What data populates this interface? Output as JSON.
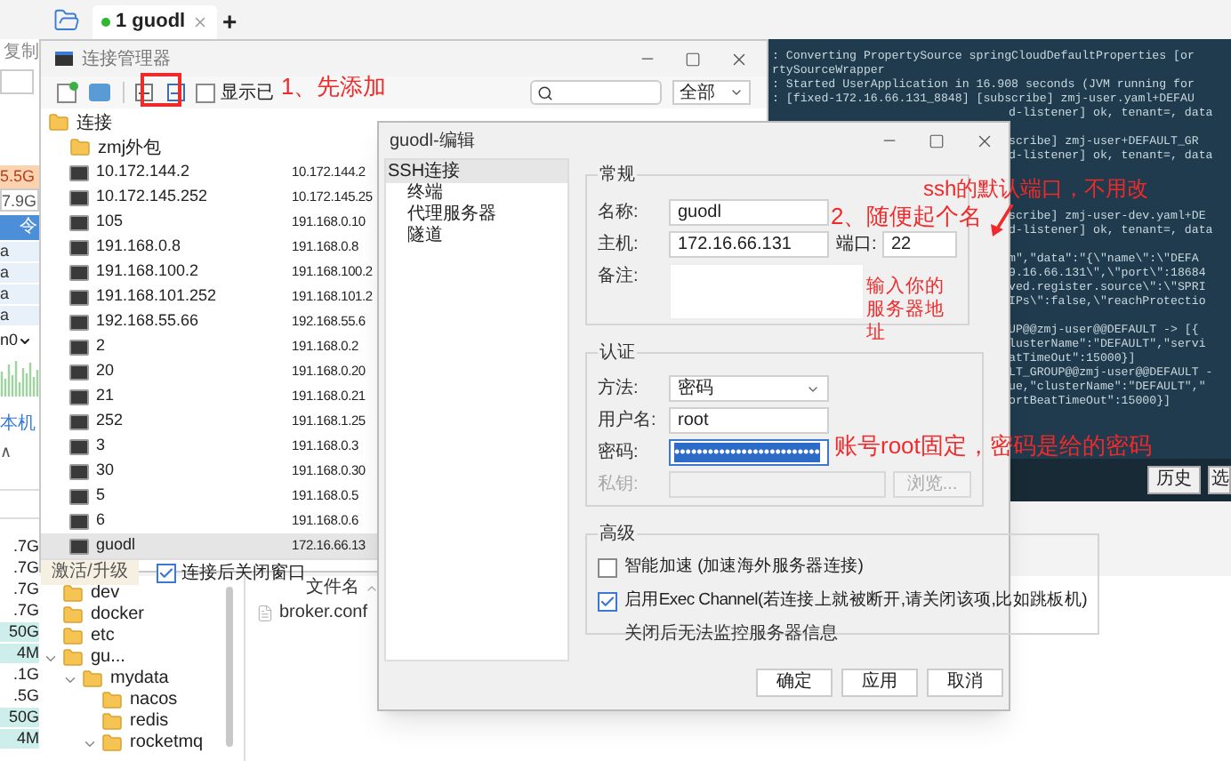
{
  "left_strip": {
    "copy_label": "复制",
    "disk_badges": [
      {
        "text": "5.5G",
        "kind": "warn"
      },
      {
        "text": "7.9G",
        "kind": "plain"
      }
    ],
    "command_fragment": "令",
    "rows": [
      "a",
      "a",
      "a",
      "a"
    ],
    "interface": "n0",
    "local_label": "本机",
    "sort_mark": "∧",
    "sizes": [
      {
        "text": ".7G",
        "highlighted": false
      },
      {
        "text": ".7G",
        "highlighted": false
      },
      {
        "text": ".7G",
        "highlighted": false
      },
      {
        "text": ".7G",
        "highlighted": false
      },
      {
        "text": "50G",
        "highlighted": true
      },
      {
        "text": "4M",
        "highlighted": true
      },
      {
        "text": ".1G",
        "highlighted": false
      },
      {
        "text": ".5G",
        "highlighted": false
      },
      {
        "text": "50G",
        "highlighted": true
      },
      {
        "text": "4M",
        "highlighted": true
      }
    ]
  },
  "tab_bar": {
    "tabs": [
      {
        "label": "1 guodl",
        "selected": true,
        "connected": true
      }
    ],
    "add": "+"
  },
  "terminal": {
    "blocks": [
      [
        {
          "kind": "full",
          "text": ": Converting PropertySource springCloudDefaultProperties [or"
        },
        {
          "kind": "full",
          "text": "rtySourceWrapper"
        },
        {
          "kind": "full",
          "text": ": Started UserApplication in 16.908 seconds (JVM running for"
        },
        {
          "kind": "full",
          "text": ": [fixed-172.16.66.131_8848] [subscribe] zmj-user.yaml+DEFAU"
        },
        {
          "kind": "right",
          "text": "d-listener] ok, tenant=, data"
        }
      ],
      [
        {
          "kind": "right",
          "text": "scribe] zmj-user+DEFAULT_GR"
        },
        {
          "kind": "right",
          "text": "d-listener] ok, tenant=, data"
        }
      ],
      [
        {
          "kind": "right",
          "text": "scribe] zmj-user-dev.yaml+DE"
        },
        {
          "kind": "right",
          "text": "d-listener] ok, tenant=, data"
        }
      ],
      [
        {
          "kind": "right",
          "text": "m\",\"data\":\"{\\\"name\\\":\\\"DEFA"
        },
        {
          "kind": "right",
          "text": "9.16.66.131\\\",\\\"port\\\":18684"
        },
        {
          "kind": "right",
          "text": "ved.register.source\\\":\\\"SPRI"
        },
        {
          "kind": "right",
          "text": "IPs\\\":false,\\\"reachProtectio"
        }
      ],
      [
        {
          "kind": "right",
          "text": "UP@@zmj-user@@DEFAULT -> [{"
        },
        {
          "kind": "right",
          "text": "lusterName\":\"DEFAULT\",\"servi"
        },
        {
          "kind": "right",
          "text": "atTimeOut\":15000}]"
        },
        {
          "kind": "right",
          "text": "LT_GROUP@@zmj-user@@DEFAULT -"
        },
        {
          "kind": "right",
          "text": "ue,\"clusterName\":\"DEFAULT\",\""
        },
        {
          "kind": "right",
          "text": "ortBeatTimeOut\":15000}]"
        }
      ]
    ],
    "buttons": [
      "历史",
      "选"
    ]
  },
  "file_browser": {
    "tree": [
      {
        "name": "dev"
      },
      {
        "name": "docker"
      },
      {
        "name": "etc"
      },
      {
        "name": "gu...",
        "expanded": true,
        "children": [
          {
            "name": "mydata",
            "expanded": true,
            "children": [
              {
                "name": "nacos"
              },
              {
                "name": "redis"
              },
              {
                "name": "rocketmq",
                "expanded": true
              }
            ]
          }
        ]
      }
    ],
    "column": "文件名",
    "files": [
      "broker.conf"
    ]
  },
  "connection_manager": {
    "title": "连接管理器",
    "show_toggle": {
      "label": "显示已",
      "checked": false
    },
    "filter": "全部",
    "tree": [
      {
        "kind": "folder",
        "name": "连接",
        "selected": false,
        "children": [
          {
            "kind": "folder",
            "name": "zmj外包",
            "selected": false
          },
          {
            "kind": "server",
            "name": "10.172.144.2",
            "host": "10.172.144.2",
            "selected": false
          },
          {
            "kind": "server",
            "name": "10.172.145.252",
            "host": "10.172.145.25",
            "selected": false
          },
          {
            "kind": "server",
            "name": "105",
            "host": "191.168.0.10",
            "selected": false
          },
          {
            "kind": "server",
            "name": "191.168.0.8",
            "host": "191.168.0.8",
            "selected": false
          },
          {
            "kind": "server",
            "name": "191.168.100.2",
            "host": "191.168.100.2",
            "selected": false
          },
          {
            "kind": "server",
            "name": "191.168.101.252",
            "host": "191.168.101.2",
            "selected": false
          },
          {
            "kind": "server",
            "name": "192.168.55.66",
            "host": "192.168.55.6",
            "selected": false
          },
          {
            "kind": "server",
            "name": "2",
            "host": "191.168.0.2",
            "selected": false
          },
          {
            "kind": "server",
            "name": "20",
            "host": "191.168.0.20",
            "selected": false
          },
          {
            "kind": "server",
            "name": "21",
            "host": "191.168.0.21",
            "selected": false
          },
          {
            "kind": "server",
            "name": "252",
            "host": "191.168.1.25",
            "selected": false
          },
          {
            "kind": "server",
            "name": "3",
            "host": "191.168.0.3",
            "selected": false
          },
          {
            "kind": "server",
            "name": "30",
            "host": "191.168.0.30",
            "selected": false
          },
          {
            "kind": "server",
            "name": "5",
            "host": "191.168.0.5",
            "selected": false
          },
          {
            "kind": "server",
            "name": "6",
            "host": "191.168.0.6",
            "selected": false
          },
          {
            "kind": "server",
            "name": "guodl",
            "host": "172.16.66.13",
            "selected": true
          }
        ]
      }
    ],
    "footer": {
      "tab": "激活/升级",
      "close_after": {
        "label": "连接后关闭窗口",
        "checked": true
      }
    }
  },
  "edit_dialog": {
    "title": "guodl-编辑",
    "nav": [
      {
        "label": "SSH连接",
        "selected": true,
        "children": [
          {
            "label": "终端",
            "selected": false
          },
          {
            "label": "代理服务器",
            "selected": false
          },
          {
            "label": "隧道",
            "selected": false
          }
        ]
      }
    ],
    "general": {
      "legend": "常规",
      "name_label": "名称:",
      "name": "guodl",
      "host_label": "主机:",
      "host": "172.16.66.131",
      "port_label": "端口:",
      "port": "22",
      "note_label": "备注:"
    },
    "auth": {
      "legend": "认证",
      "method_label": "方法:",
      "method": "密码",
      "user_label": "用户名:",
      "user": "root",
      "password_label": "密码:",
      "password": "••••••••••••••••••••••••••",
      "key_label": "私钥:",
      "key_disabled": true,
      "browse": "浏览...",
      "browse_disabled": true
    },
    "advanced": {
      "legend": "高级",
      "options": [
        {
          "label": "智能加速 (加速海外服务器连接)",
          "checked": false
        },
        {
          "label": "启用Exec Channel(若连接上就被断开,请关闭该项,比如跳板机)",
          "checked": true
        }
      ],
      "note": "关闭后无法监控服务器信息"
    },
    "buttons": [
      "确定",
      "应用",
      "取消"
    ]
  },
  "annotations": [
    {
      "kind": "step_add",
      "text": "1、先添加"
    },
    {
      "kind": "step_name",
      "text": "2、随便起个名"
    },
    {
      "kind": "host_hint",
      "text": "输入你的服务器地址"
    },
    {
      "kind": "port_hint",
      "text": "ssh的默认端口，不用改"
    },
    {
      "kind": "auth_hint",
      "text": "账号root固定，密码是给的密码"
    }
  ]
}
